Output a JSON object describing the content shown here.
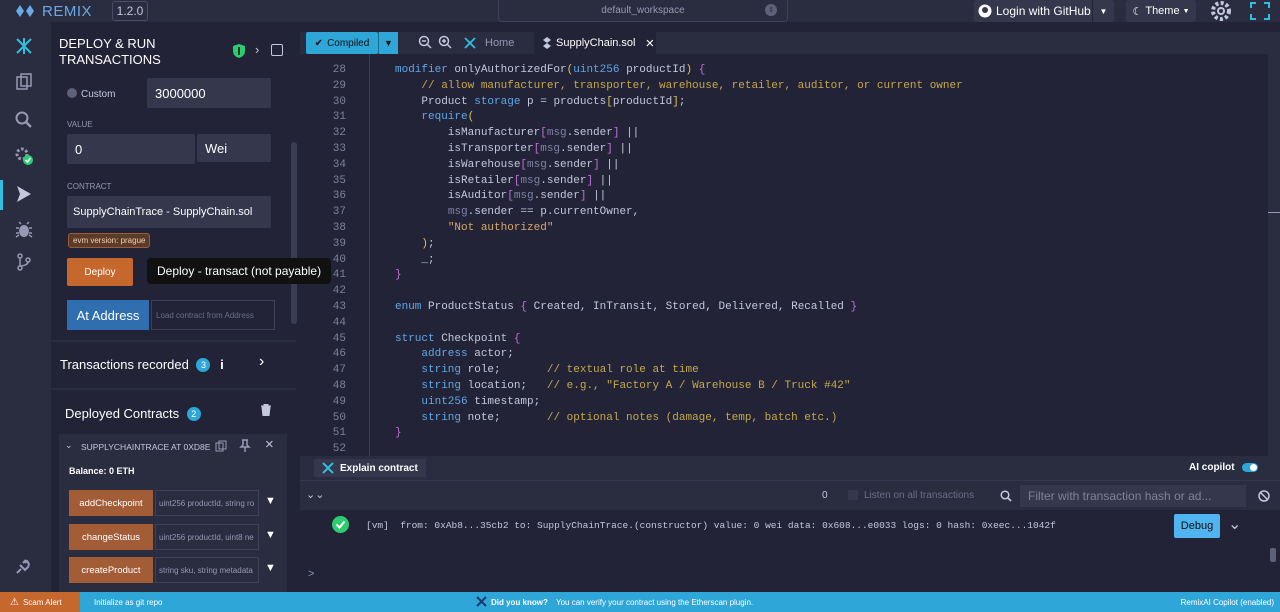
{
  "app": {
    "name": "REMIX",
    "version": "1.2.0",
    "workspace": "default_workspace",
    "login_label": "Login with GitHub",
    "theme_label": "Theme"
  },
  "panel": {
    "title_line1": "DEPLOY & RUN",
    "title_line2": "TRANSACTIONS",
    "gas_option_label": "Custom",
    "gas_value": "3000000",
    "value_label": "VALUE",
    "value_amount": "0",
    "value_unit": "Wei",
    "contract_label": "CONTRACT",
    "contract_selected": "SupplyChainTrace - SupplyChain.sol",
    "evm_badge": "evm version: prague",
    "deploy_label": "Deploy",
    "deploy_tooltip": "Deploy - transact (not payable)",
    "at_address_label": "At Address",
    "at_address_placeholder": "Load contract from Address",
    "transactions_label": "Transactions recorded",
    "transactions_count": "3",
    "info_glyph": "i",
    "deployed_label": "Deployed Contracts",
    "deployed_count": "2",
    "instance_name": "SUPPLYCHAINTRACE AT 0XD8E",
    "balance": "Balance: 0 ETH",
    "functions": [
      {
        "name": "addCheckpoint",
        "params": "uint256 productId, string ro"
      },
      {
        "name": "changeStatus",
        "params": "uint256 productId, uint8 ne"
      },
      {
        "name": "createProduct",
        "params": "string sku, string metadata"
      }
    ]
  },
  "tabs": {
    "compiled_label": "Compiled",
    "home_label": "Home",
    "file_label": "SupplyChain.sol"
  },
  "editor": {
    "lines": [
      {
        "n": "28",
        "html": "<span class='kw'>modifier</span> onlyAuthorizedFor<span class='br'>(</span><span class='ty'>uint256</span> productId<span class='br'>)</span> <span class='pu'>{</span>"
      },
      {
        "n": "29",
        "html": "    <span class='cm'>// allow manufacturer, transporter, warehouse, retailer, auditor, or current owner</span>"
      },
      {
        "n": "30",
        "html": "    Product <span class='kw'>storage</span> p = products<span class='br'>[</span>productId<span class='br'>]</span>;"
      },
      {
        "n": "31",
        "html": "    <span class='kw'>require</span><span class='br'>(</span>"
      },
      {
        "n": "32",
        "html": "        isManufacturer<span class='pu'>[</span><span class='dim'>msg</span>.sender<span class='pu'>]</span> ||"
      },
      {
        "n": "33",
        "html": "        isTransporter<span class='pu'>[</span><span class='dim'>msg</span>.sender<span class='pu'>]</span> ||"
      },
      {
        "n": "34",
        "html": "        isWarehouse<span class='pu'>[</span><span class='dim'>msg</span>.sender<span class='pu'>]</span> ||"
      },
      {
        "n": "35",
        "html": "        isRetailer<span class='pu'>[</span><span class='dim'>msg</span>.sender<span class='pu'>]</span> ||"
      },
      {
        "n": "36",
        "html": "        isAuditor<span class='pu'>[</span><span class='dim'>msg</span>.sender<span class='pu'>]</span> ||"
      },
      {
        "n": "37",
        "html": "        <span class='dim'>msg</span>.sender == p.currentOwner,"
      },
      {
        "n": "38",
        "html": "        <span class='st'>\"Not authorized\"</span>"
      },
      {
        "n": "39",
        "html": "    <span class='br'>)</span>;"
      },
      {
        "n": "40",
        "html": "    _;"
      },
      {
        "n": "41",
        "html": "<span class='pu'>}</span>"
      },
      {
        "n": "42",
        "html": ""
      },
      {
        "n": "43",
        "html": "<span class='kw'>enum</span> ProductStatus <span class='pu'>{</span> Created, InTransit, Stored, Delivered, Recalled <span class='pu'>}</span>"
      },
      {
        "n": "44",
        "html": ""
      },
      {
        "n": "45",
        "html": "<span class='kw'>struct</span> Checkpoint <span class='pu'>{</span>"
      },
      {
        "n": "46",
        "html": "    <span class='ty'>address</span> actor;"
      },
      {
        "n": "47",
        "html": "    <span class='ty'>string</span> role;       <span class='cm'>// textual role at time</span>"
      },
      {
        "n": "48",
        "html": "    <span class='ty'>string</span> location;   <span class='cm'>// e.g., \"Factory A / Warehouse B / Truck #42\"</span>"
      },
      {
        "n": "49",
        "html": "    <span class='ty'>uint256</span> timestamp;"
      },
      {
        "n": "50",
        "html": "    <span class='ty'>string</span> note;       <span class='cm'>// optional notes (damage, temp, batch etc.)</span>"
      },
      {
        "n": "51",
        "html": "<span class='pu'>}</span>"
      },
      {
        "n": "52",
        "html": ""
      }
    ]
  },
  "terminal": {
    "explain_label": "Explain contract",
    "copilot_label": "AI copilot",
    "pending_count": "0",
    "listen_label": "Listen on all transactions",
    "filter_placeholder": "Filter with transaction hash or ad...",
    "tx_line": "[vm]  from: 0xAb8...35cb2 to: SupplyChainTrace.(constructor) value: 0 wei data: 0x608...e0033 logs: 0 hash: 0xeec...1042f",
    "debug_label": "Debug",
    "prompt": ">"
  },
  "statusbar": {
    "scam_label": "Scam Alert",
    "git_label": "Initialize as git repo",
    "tip_title": "Did you know?",
    "tip_text": "You can verify your contract using the Etherscan plugin.",
    "copilot_status": "RemixAI Copilot (enabled)"
  }
}
